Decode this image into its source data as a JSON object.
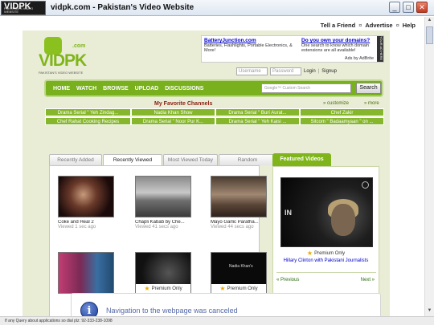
{
  "window": {
    "logo_text": "VIDPK",
    "logo_subtext": "PAKISTAN'S VIDEO WEBSITE",
    "title": "vidpk.com - Pakistan's Video Website",
    "controls": [
      "_",
      "□",
      "✕"
    ]
  },
  "toplinks": {
    "tell_friend": "Tell a Friend",
    "advertise": "Advertise",
    "help": "Help",
    "separator": "¤"
  },
  "site": {
    "logo": "VIDPK",
    "logo_domain": ".com",
    "tagline": "PAKISTAN'S VIDEO WEBSITE"
  },
  "ads": {
    "ad1_title": "BatteryJunction.com",
    "ad1_text": "Batteries, Flashlights, Portable Electronics, & More!",
    "ad2_title": "Do you own your domains?",
    "ad2_text": "One search to know which domain extensions are all available!",
    "ads_by": "Ads by AdBrite",
    "side_text": "YOUR AD HERE"
  },
  "login": {
    "username_placeholder": "Username",
    "password_placeholder": "Password",
    "login": "Login",
    "signup": "Signup",
    "sep": "|"
  },
  "nav": {
    "items": [
      "HOME",
      "WATCH",
      "BROWSE",
      "UPLOAD",
      "DISCUSSIONS"
    ],
    "search_placeholder": "Google™ Custom Search",
    "search_button": "Search"
  },
  "favorites": {
    "heading": "My Favorite Channels",
    "customize": "» customize",
    "more": "» more",
    "channels": [
      "Drama Serial \" Yeh Zindag...",
      "Nadia Khan Show",
      "Drama Serial \" Burí Aurat...",
      "Chef Zakir",
      "Chef Rahat Cooking Recipes",
      "Drama Serial \" Noor Pur K...",
      "Drama Serial \" Yeh Kaisi ...",
      "Sitcom \" Badaamyaan \" on ..."
    ]
  },
  "tabs": [
    "Recently Added",
    "Recently Viewed",
    "Most Viewed Today",
    "Random"
  ],
  "videos": [
    {
      "title": "Coke and Heal 2",
      "meta": "Viewed 1 sec ago"
    },
    {
      "title": "Chapli Kabab by Che...",
      "meta": "Viewed 41 secs ago"
    },
    {
      "title": "Mayo Garlic Paratha...",
      "meta": "Viewed 44 secs ago"
    },
    {
      "title": "",
      "meta": ""
    },
    {
      "title": "Premium Only",
      "meta": ""
    },
    {
      "title": "Premium Only",
      "meta": ""
    }
  ],
  "featured": {
    "tab": "Featured Videos",
    "badge": "Premium Only",
    "caption": "Hillary Clinton with Pakistani Journalists",
    "prev": "« Previous",
    "next": "Next »",
    "overlay_text": "IN",
    "thumb_text": "Nadia Khan's"
  },
  "notification": {
    "icon_letter": "i",
    "message": "Navigation to the webpage was canceled"
  },
  "status_text": "If any Query about applications so dial plz: 92-333-238-1098",
  "colors": {
    "brand_green": "#7fb51a",
    "nav_green": "#79b01e",
    "page_bg": "#e9edd6",
    "link_blue": "#0000cc"
  }
}
